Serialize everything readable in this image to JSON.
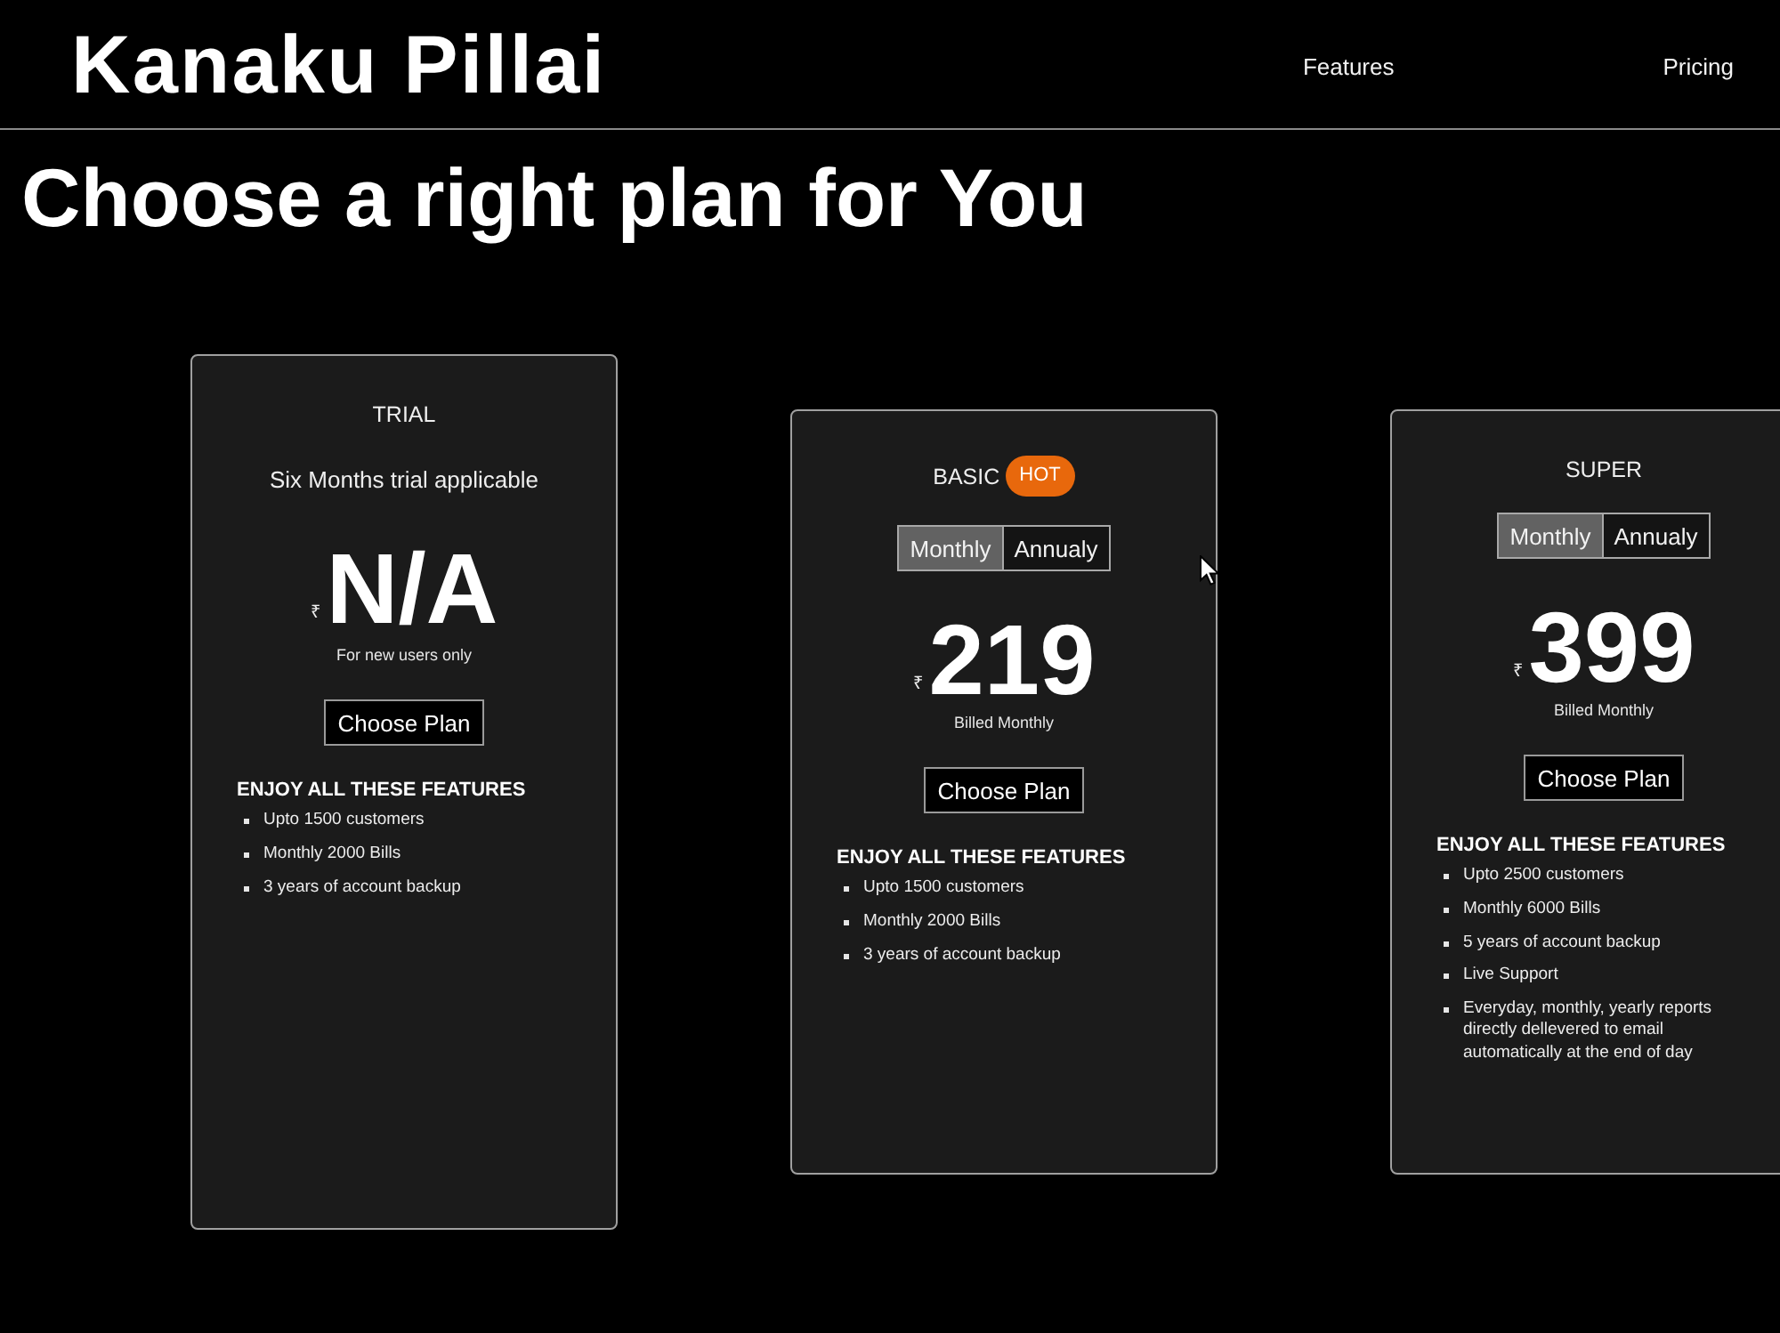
{
  "header": {
    "logo": "Kanaku Pillai",
    "nav": [
      {
        "label": "Features"
      },
      {
        "label": "Pricing"
      }
    ]
  },
  "heading": "Choose a right plan for You",
  "plans": [
    {
      "kind": "trial",
      "name": "TRIAL",
      "subtitle": "Six Months trial applicable",
      "currency": "₹",
      "price": "N/A",
      "note": "For new users only",
      "button": "Choose Plan",
      "features_title": "ENJOY ALL THESE FEATURES",
      "features": [
        "Upto 1500 customers",
        "Monthly 2000 Bills",
        "3 years of account backup"
      ]
    },
    {
      "kind": "paid",
      "name": "BASIC",
      "badge": "HOT",
      "billing": [
        {
          "label": "Monthly",
          "selected": true
        },
        {
          "label": "Annualy",
          "selected": false
        }
      ],
      "currency": "₹",
      "price": "219",
      "note": "Billed Monthly",
      "button": "Choose Plan",
      "features_title": "ENJOY ALL THESE FEATURES",
      "features": [
        "Upto 1500 customers",
        "Monthly 2000 Bills",
        "3 years of account backup"
      ]
    },
    {
      "kind": "paid",
      "name": "SUPER",
      "billing": [
        {
          "label": "Monthly",
          "selected": true
        },
        {
          "label": "Annualy",
          "selected": false
        }
      ],
      "currency": "₹",
      "price": "399",
      "note": "Billed Monthly",
      "button": "Choose Plan",
      "features_title": "ENJOY ALL THESE FEATURES",
      "features": [
        "Upto 2500 customers",
        "Monthly 6000 Bills",
        "5 years of account backup",
        "Live Support",
        "Everyday, monthly, yearly reports directly dellevered to email automatically at the end of day"
      ]
    }
  ]
}
